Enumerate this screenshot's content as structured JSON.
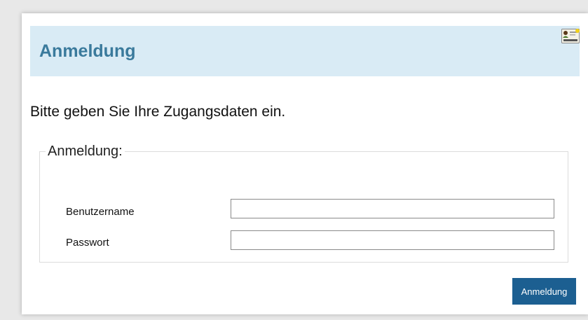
{
  "header": {
    "title": "Anmeldung",
    "icon": "id-card-icon"
  },
  "instruction": "Bitte geben Sie Ihre Zugangsdaten ein.",
  "form": {
    "legend": "Anmeldung:",
    "username_label": "Benutzername",
    "username_value": "",
    "password_label": "Passwort",
    "password_value": ""
  },
  "submit_label": "Anmeldung",
  "colors": {
    "header_bg": "#d9ebf5",
    "title": "#3a7a9c",
    "button": "#1c5f91"
  }
}
